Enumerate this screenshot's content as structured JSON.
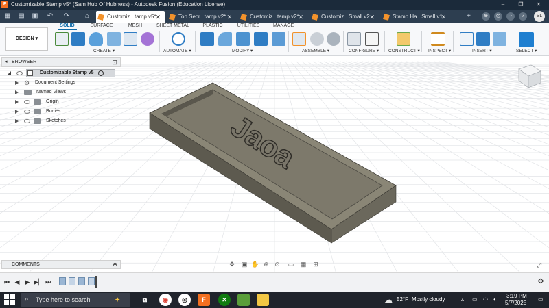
{
  "window": {
    "title": "Customizable Stamp v5* (Sam Hub Of Hubness) - Autodesk Fusion (Education License)",
    "logo_letter": "F",
    "controls": [
      "–",
      "❐",
      "✕"
    ]
  },
  "tabs": [
    {
      "label": "Customiz...tamp v5*",
      "active": true
    },
    {
      "label": "Top Secr...tamp v2*",
      "active": false
    },
    {
      "label": "Customiz...tamp v2*",
      "active": false
    },
    {
      "label": "Customiz...Small v2",
      "active": false
    },
    {
      "label": "Stamp Ha...Small v1",
      "active": false
    }
  ],
  "tab_close": "✕",
  "user_initials": "SL",
  "toolbar": {
    "design_label": "DESIGN ▾",
    "workspace_tabs": [
      "SOLID",
      "SURFACE",
      "MESH",
      "SHEET METAL",
      "PLASTIC",
      "UTILITIES",
      "MANAGE"
    ],
    "groups": [
      "CREATE ▾",
      "AUTOMATE ▾",
      "MODIFY ▾",
      "ASSEMBLE ▾",
      "CONFIGURE ▾",
      "CONSTRUCT ▾",
      "INSPECT ▾",
      "INSERT ▾",
      "SELECT ▾"
    ]
  },
  "browser": {
    "header": "BROWSER",
    "root": "Customizable Stamp v5",
    "items": [
      "Document Settings",
      "Named Views",
      "Origin",
      "Bodies",
      "Sketches"
    ]
  },
  "comments_label": "COMMENTS",
  "model_text": "Jaoa",
  "taskbar": {
    "search_placeholder": "Type here to search",
    "weather_temp": "52°F",
    "weather_desc": "Mostly cloudy",
    "time": "3:19 PM",
    "date": "5/7/2025"
  },
  "colors": {
    "titlebar": "#1b2a3a",
    "tabbar": "#2d3e50",
    "accent": "#0d6aa8",
    "model_top": "#8a8676",
    "model_side": "#5d5a4f",
    "fusion_orange": "#f37021"
  }
}
